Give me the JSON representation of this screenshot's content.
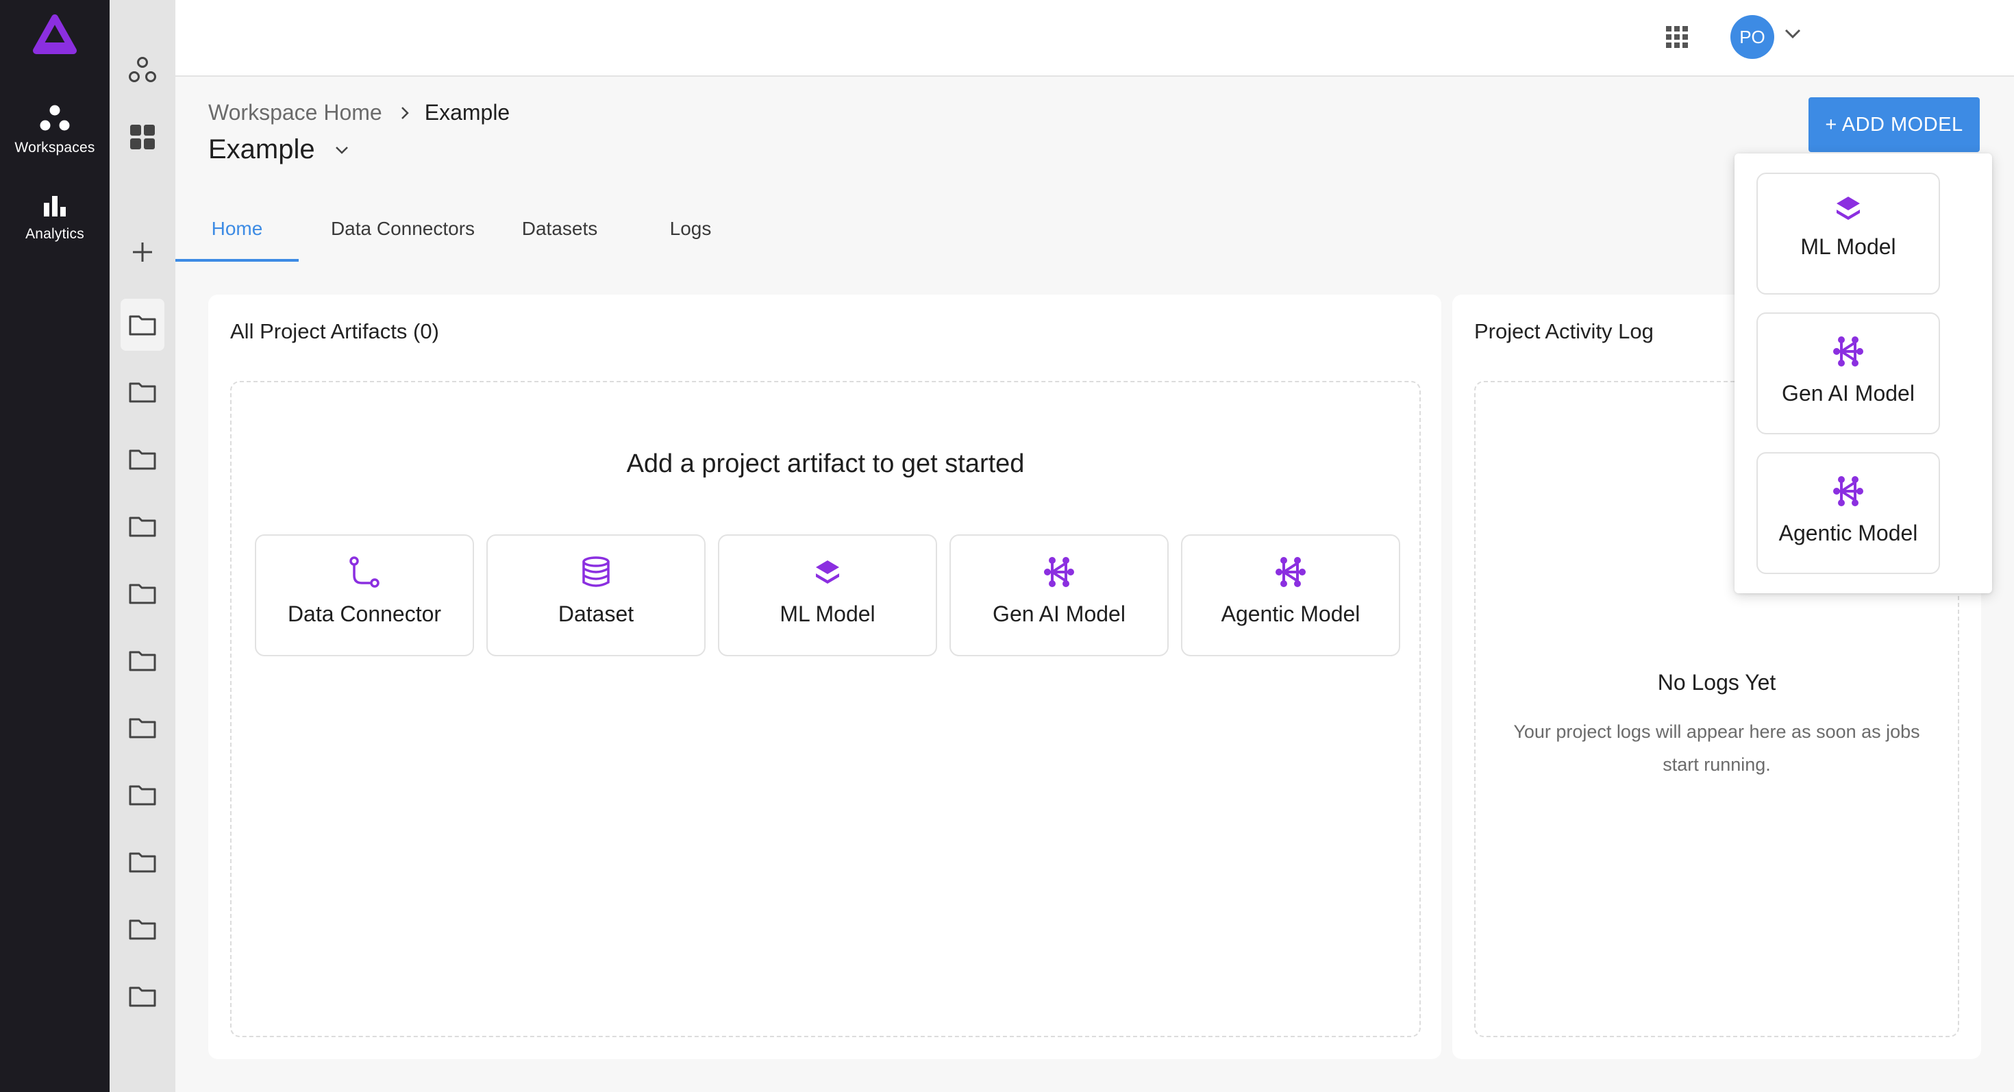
{
  "app": {
    "brand_color": "#8b2fe0",
    "accent_color": "#3d8be4"
  },
  "rail": {
    "items": [
      {
        "label": "Workspaces",
        "icon": "workspaces-icon"
      },
      {
        "label": "Analytics",
        "icon": "analytics-icon"
      }
    ]
  },
  "topbar": {
    "avatar_initials": "PO"
  },
  "header": {
    "breadcrumb_root": "Workspace Home",
    "breadcrumb_current": "Example",
    "title": "Example",
    "add_model_label": "+ ADD MODEL"
  },
  "tabs": [
    {
      "label": "Home",
      "active": true
    },
    {
      "label": "Data Connectors",
      "active": false
    },
    {
      "label": "Datasets",
      "active": false
    },
    {
      "label": "Logs",
      "active": false
    }
  ],
  "artifacts": {
    "title": "All Project Artifacts (0)",
    "empty_heading": "Add a project artifact to get started",
    "tiles": [
      {
        "label": "Data Connector",
        "icon": "data-connector-icon"
      },
      {
        "label": "Dataset",
        "icon": "database-icon"
      },
      {
        "label": "ML Model",
        "icon": "layers-icon"
      },
      {
        "label": "Gen AI Model",
        "icon": "network-icon"
      },
      {
        "label": "Agentic Model",
        "icon": "network-icon"
      }
    ]
  },
  "activity": {
    "title": "Project Activity Log",
    "empty_title": "No Logs Yet",
    "empty_desc": "Your project logs will appear here as soon as jobs start running."
  },
  "dropdown": {
    "items": [
      {
        "label": "ML Model",
        "icon": "layers-icon"
      },
      {
        "label": "Gen AI Model",
        "icon": "network-icon"
      },
      {
        "label": "Agentic Model",
        "icon": "network-icon"
      }
    ]
  }
}
